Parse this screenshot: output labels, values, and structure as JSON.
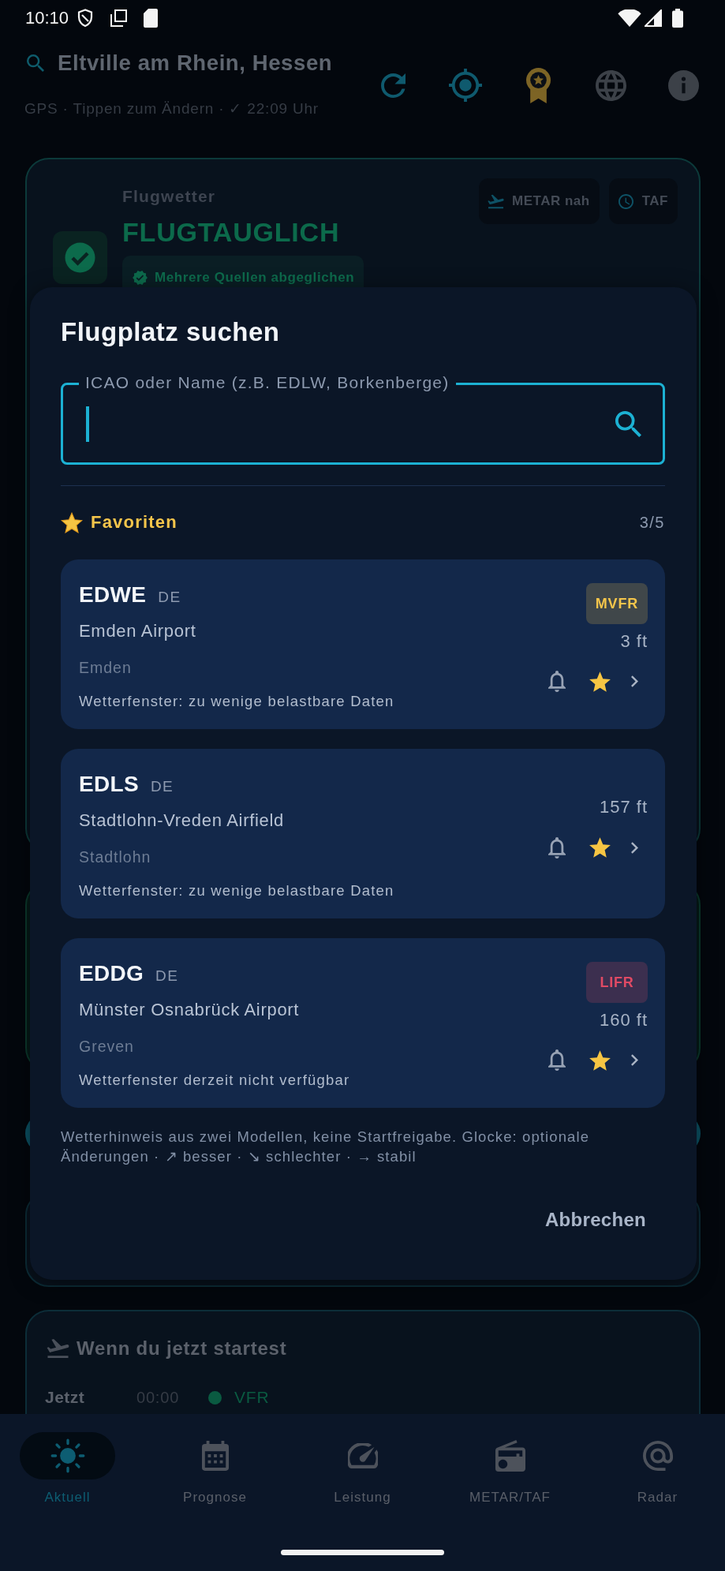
{
  "status_bar": {
    "time": "10:10"
  },
  "header": {
    "location": "Eltville am Rhein, Hessen",
    "subtitle": "GPS · Tippen zum Ändern · ✓ 22:09 Uhr"
  },
  "weather_card": {
    "label": "Flugwetter",
    "verdict": "FLUGTAUGLICH",
    "sources_badge": "Mehrere Quellen abgeglichen",
    "chips": [
      "METAR nah",
      "TAF"
    ]
  },
  "dialog": {
    "title": "Flugplatz suchen",
    "search": {
      "label": "ICAO oder Name (z.B. EDLW, Borkenberge)",
      "focused": true
    },
    "favorites": {
      "title": "Favoriten",
      "count": "3/5",
      "items": [
        {
          "code": "EDWE",
          "country": "DE",
          "name": "Emden Airport",
          "city": "Emden",
          "forecast": "Wetterfenster: zu wenige belastbare Daten",
          "badge": {
            "text": "MVFR",
            "color": "#f4c54b"
          },
          "elevation": "3 ft",
          "alert": false,
          "favorite": true
        },
        {
          "code": "EDLS",
          "country": "DE",
          "name": "Stadtlohn-Vreden Airfield",
          "city": "Stadtlohn",
          "forecast": "Wetterfenster: zu wenige belastbare Daten",
          "elevation": "157 ft",
          "alert": false,
          "favorite": true
        },
        {
          "code": "EDDG",
          "country": "DE",
          "name": "Münster Osnabrück Airport",
          "city": "Greven",
          "forecast": "Wetterfenster derzeit nicht verfügbar",
          "badge": {
            "text": "LIFR",
            "color": "#e04a64"
          },
          "elevation": "160 ft",
          "alert": false,
          "favorite": true
        }
      ]
    },
    "note": "Wetterhinweis aus zwei Modellen, keine Startfreigabe. Glocke: optionale Änderungen · ↗ besser · ↘ schlechter · → stabil",
    "cancel": "Abbrechen"
  },
  "departure_card": {
    "title": "Wenn du jetzt startest",
    "rows": [
      {
        "label": "Jetzt",
        "time": "00:00",
        "color": "#0a5a41",
        "category": "VFR"
      }
    ]
  },
  "bottom_nav": [
    {
      "label": "Aktuell",
      "selected": true
    },
    {
      "label": "Prognose",
      "selected": false
    },
    {
      "label": "Leistung",
      "selected": false
    },
    {
      "label": "METAR/TAF",
      "selected": false
    },
    {
      "label": "Radar",
      "selected": false
    }
  ]
}
